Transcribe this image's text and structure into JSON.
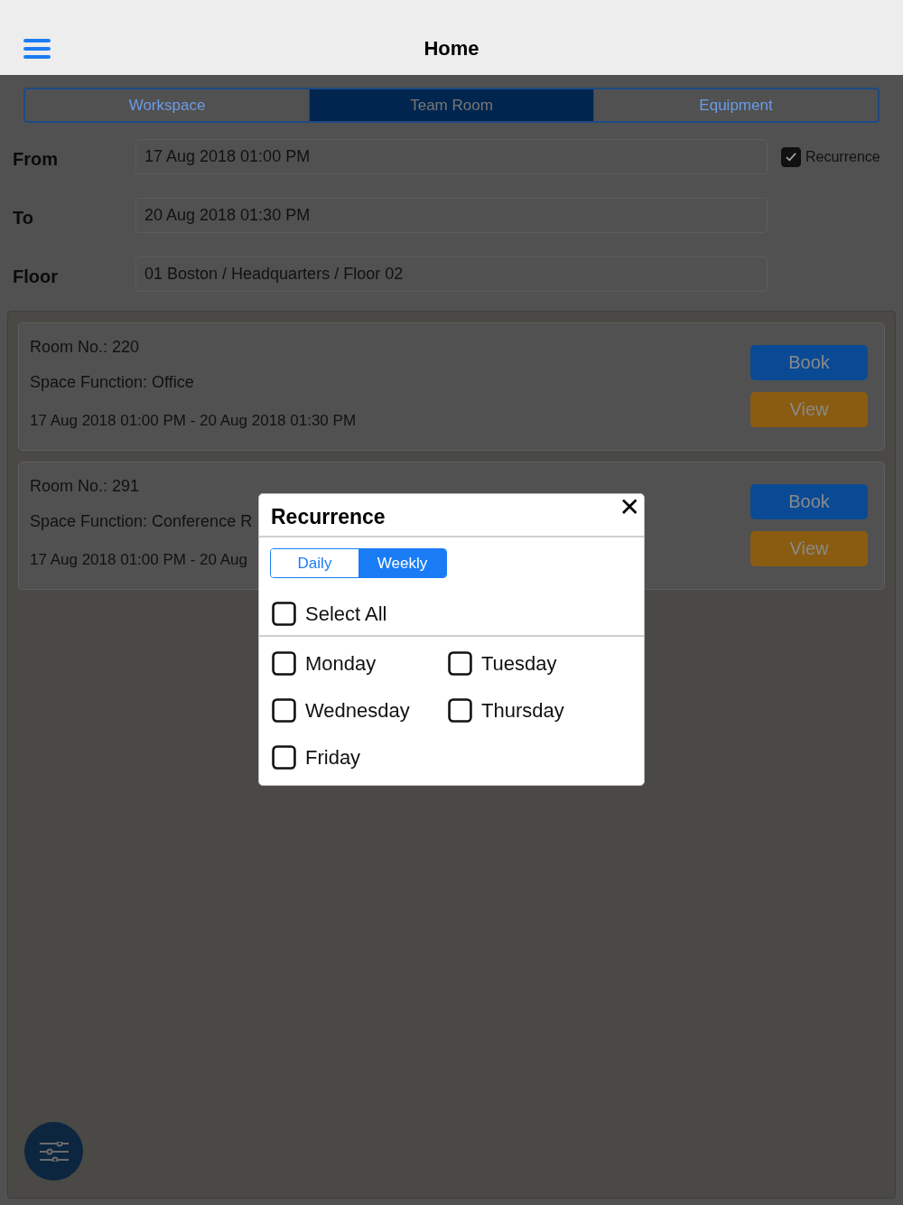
{
  "header": {
    "title": "Home"
  },
  "tabs": [
    {
      "label": "Workspace",
      "selected": false
    },
    {
      "label": "Team Room",
      "selected": true
    },
    {
      "label": "Equipment",
      "selected": false
    }
  ],
  "form": [
    {
      "label": "From",
      "value": "17 Aug 2018 01:00 PM"
    },
    {
      "label": "To",
      "value": "20 Aug 2018 01:30 PM"
    },
    {
      "label": "Floor",
      "value": "01 Boston / Headquarters / Floor 02"
    }
  ],
  "recurrence_option": {
    "label": "Recurrence",
    "checked": true
  },
  "rooms": [
    {
      "room_no": "Room No.: 220",
      "function": "Space Function: Office",
      "period": "17 Aug 2018 01:00 PM - 20 Aug 2018 01:30 PM",
      "buttons": [
        "Book",
        "View"
      ]
    },
    {
      "room_no": "Room No.: 291",
      "function": "Space Function: Conference R",
      "period": "17 Aug 2018 01:00 PM - 20 Aug",
      "buttons": [
        "Book",
        "View"
      ]
    }
  ],
  "dialog": {
    "title": "Recurrence",
    "close": "✕",
    "modes": [
      {
        "label": "Daily",
        "selected": false
      },
      {
        "label": "Weekly",
        "selected": true
      }
    ],
    "select_all": {
      "label": "Select All",
      "checked": false
    },
    "days": [
      {
        "label": "Monday",
        "checked": false
      },
      {
        "label": "Tuesday",
        "checked": false
      },
      {
        "label": "Wednesday",
        "checked": false
      },
      {
        "label": "Thursday",
        "checked": false
      },
      {
        "label": "Friday",
        "checked": false
      }
    ]
  }
}
